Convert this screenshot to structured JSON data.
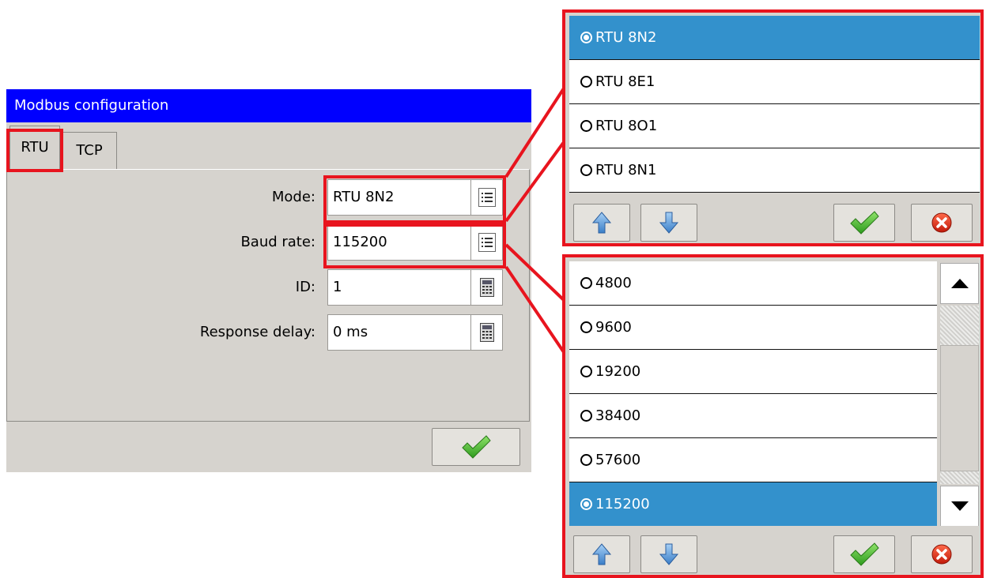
{
  "dialog": {
    "title": "Modbus configuration",
    "tabs": [
      {
        "label": "RTU"
      },
      {
        "label": "TCP"
      }
    ],
    "fields": {
      "mode": {
        "label": "Mode:",
        "value": "RTU 8N2",
        "button_icon": "list-icon"
      },
      "baud_rate": {
        "label": "Baud rate:",
        "value": "115200",
        "button_icon": "list-icon"
      },
      "id": {
        "label": "ID:",
        "value": "1",
        "button_icon": "calculator-icon"
      },
      "response_delay": {
        "label": "Response delay:",
        "value": "0 ms",
        "button_icon": "calculator-icon"
      }
    },
    "confirm_icon": "check-icon"
  },
  "mode_popup": {
    "options": [
      {
        "label": "RTU 8N2",
        "selected": true
      },
      {
        "label": "RTU 8E1",
        "selected": false
      },
      {
        "label": "RTU 8O1",
        "selected": false
      },
      {
        "label": "RTU 8N1",
        "selected": false
      }
    ],
    "buttons": [
      "arrow-up-icon",
      "arrow-down-icon",
      "check-icon",
      "cancel-icon"
    ]
  },
  "baud_popup": {
    "options": [
      {
        "label": "4800",
        "selected": false
      },
      {
        "label": "9600",
        "selected": false
      },
      {
        "label": "19200",
        "selected": false
      },
      {
        "label": "38400",
        "selected": false
      },
      {
        "label": "57600",
        "selected": false
      },
      {
        "label": "115200",
        "selected": true
      }
    ],
    "buttons": [
      "arrow-up-icon",
      "arrow-down-icon",
      "check-icon",
      "cancel-icon"
    ]
  },
  "colors": {
    "title_bar": "#0000ff",
    "selection": "#3391cc",
    "highlight": "#e8141e",
    "panel": "#d6d3ce"
  }
}
